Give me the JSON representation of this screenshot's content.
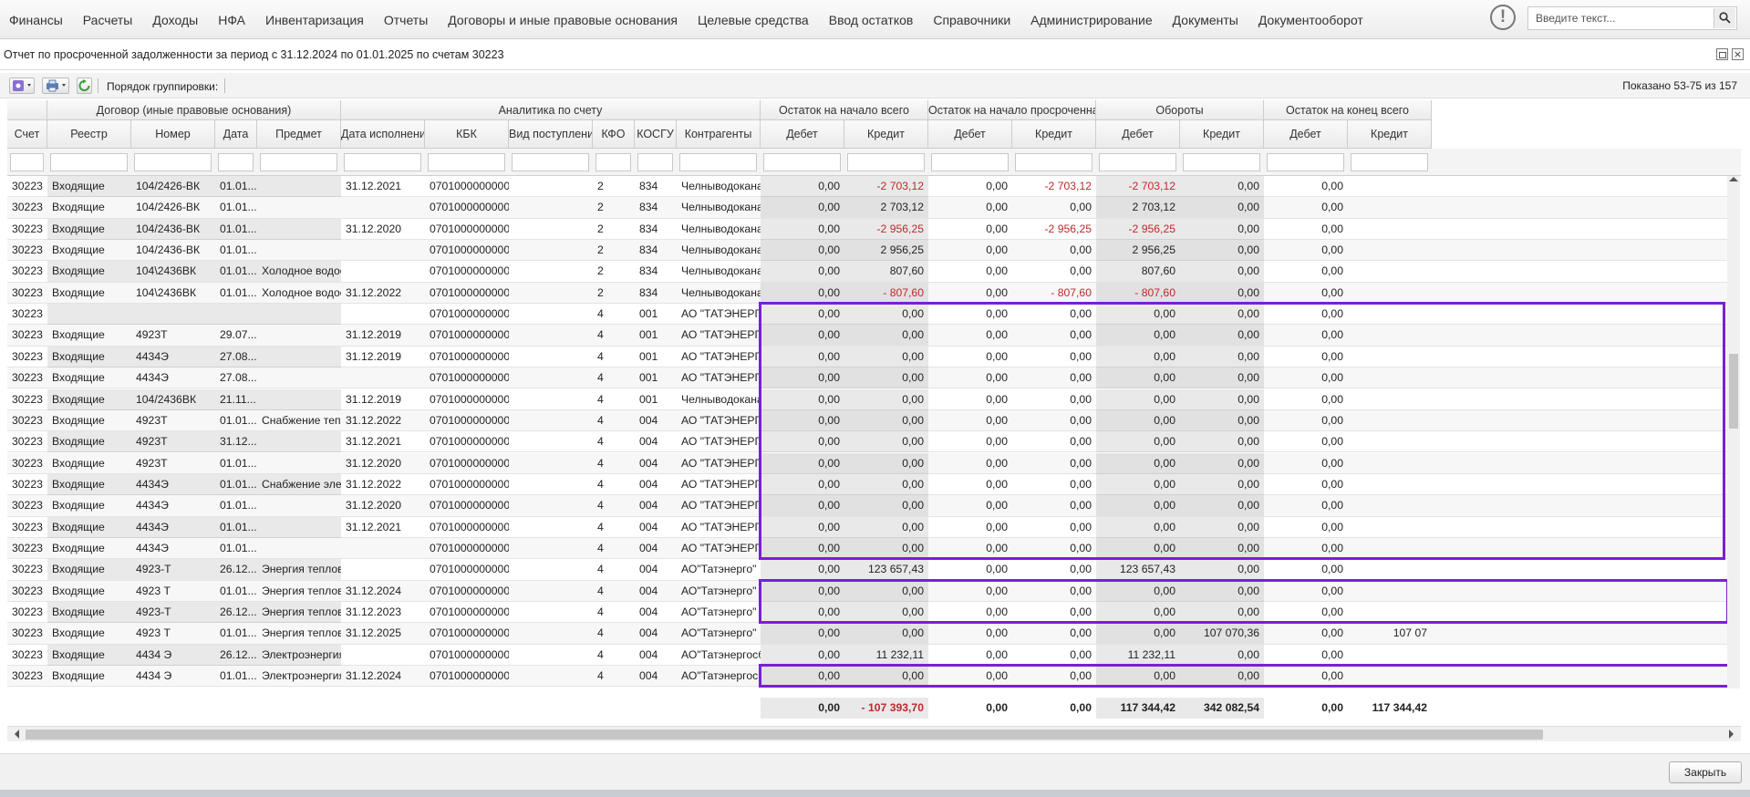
{
  "menu": [
    "Финансы",
    "Расчеты",
    "Доходы",
    "НФА",
    "Инвентаризация",
    "Отчеты",
    "Договоры и иные правовые основания",
    "Целевые средства",
    "Ввод остатков",
    "Справочники",
    "Администрирование",
    "Документы",
    "Документооборот"
  ],
  "search": {
    "placeholder": "Введите текст..."
  },
  "alert_icon": "!",
  "window": {
    "title": "Отчет по просроченной задолженности за период с 31.12.2024 по 01.01.2025 по счетам 30223"
  },
  "toolbar": {
    "grouping_label": "Порядок группировки:",
    "shown": "Показано 53-75 из 157"
  },
  "table": {
    "groups": [
      "Договор (иные правовые основания)",
      "Аналитика по счету",
      "Остаток на начало всего",
      "Остаток на начало просроченная",
      "Обороты",
      "Остаток на конец всего"
    ],
    "columns": [
      "Счет",
      "Реестр",
      "Номер",
      "Дата",
      "Предмет",
      "Дата исполнения",
      "КБК",
      "Вид поступлени...",
      "КФО",
      "КОСГУ",
      "Контрагенты",
      "Дебет",
      "Кредит",
      "Дебет",
      "Кредит",
      "Дебет",
      "Кредит",
      "Дебет",
      "Кредит"
    ],
    "rows": [
      [
        "30223",
        "Входящие",
        "104/2426-ВК",
        "01.01...",
        "",
        "31.12.2021",
        "0701000000000...",
        "",
        "2",
        "834",
        "Челныводокана...",
        "0,00",
        "-2 703,12",
        "0,00",
        "-2 703,12",
        "-2 703,12",
        "0,00",
        "0,00",
        ""
      ],
      [
        "30223",
        "Входящие",
        "104/2426-ВК",
        "01.01...",
        "",
        "",
        "0701000000000...",
        "",
        "2",
        "834",
        "Челныводокана...",
        "0,00",
        "2 703,12",
        "0,00",
        "0,00",
        "2 703,12",
        "0,00",
        "0,00",
        ""
      ],
      [
        "30223",
        "Входящие",
        "104/2436-ВК",
        "01.01...",
        "",
        "31.12.2020",
        "0701000000000...",
        "",
        "2",
        "834",
        "Челныводокана...",
        "0,00",
        "-2 956,25",
        "0,00",
        "-2 956,25",
        "-2 956,25",
        "0,00",
        "0,00",
        ""
      ],
      [
        "30223",
        "Входящие",
        "104/2436-ВК",
        "01.01...",
        "",
        "",
        "0701000000000...",
        "",
        "2",
        "834",
        "Челныводокана...",
        "0,00",
        "2 956,25",
        "0,00",
        "0,00",
        "2 956,25",
        "0,00",
        "0,00",
        ""
      ],
      [
        "30223",
        "Входящие",
        "104\\2436ВК",
        "01.01...",
        "Холодное водос...",
        "",
        "0701000000000...",
        "",
        "2",
        "834",
        "Челныводокана...",
        "0,00",
        "807,60",
        "0,00",
        "0,00",
        "807,60",
        "0,00",
        "0,00",
        ""
      ],
      [
        "30223",
        "Входящие",
        "104\\2436ВК",
        "01.01...",
        "Холодное водос...",
        "31.12.2022",
        "0701000000000...",
        "",
        "2",
        "834",
        "Челныводокана...",
        "0,00",
        "- 807,60",
        "0,00",
        "- 807,60",
        "- 807,60",
        "0,00",
        "0,00",
        ""
      ],
      [
        "30223",
        "",
        "",
        "",
        "",
        "",
        "0701000000000...",
        "",
        "4",
        "001",
        "АО \"ТАТЭНЕРГО\"",
        "0,00",
        "0,00",
        "0,00",
        "0,00",
        "0,00",
        "0,00",
        "0,00",
        ""
      ],
      [
        "30223",
        "Входящие",
        "4923Т",
        "29.07...",
        "",
        "31.12.2019",
        "0701000000000...",
        "",
        "4",
        "001",
        "АО \"ТАТЭНЕРГО\"",
        "0,00",
        "0,00",
        "0,00",
        "0,00",
        "0,00",
        "0,00",
        "0,00",
        ""
      ],
      [
        "30223",
        "Входящие",
        "4434Э",
        "27.08...",
        "",
        "31.12.2019",
        "0701000000000...",
        "",
        "4",
        "001",
        "АО \"ТАТЭНЕРГ...",
        "0,00",
        "0,00",
        "0,00",
        "0,00",
        "0,00",
        "0,00",
        "0,00",
        ""
      ],
      [
        "30223",
        "Входящие",
        "4434Э",
        "27.08...",
        "",
        "",
        "0701000000000...",
        "",
        "4",
        "001",
        "АО \"ТАТЭНЕРГ...",
        "0,00",
        "0,00",
        "0,00",
        "0,00",
        "0,00",
        "0,00",
        "0,00",
        ""
      ],
      [
        "30223",
        "Входящие",
        "104/2436ВК",
        "21.11...",
        "",
        "31.12.2019",
        "0701000000000...",
        "",
        "4",
        "001",
        "Челныводокана...",
        "0,00",
        "0,00",
        "0,00",
        "0,00",
        "0,00",
        "0,00",
        "0,00",
        ""
      ],
      [
        "30223",
        "Входящие",
        "4923Т",
        "01.01...",
        "Снабжение теп...",
        "31.12.2022",
        "0701000000000...",
        "",
        "4",
        "004",
        "АО \"ТАТЭНЕРГО\"",
        "0,00",
        "0,00",
        "0,00",
        "0,00",
        "0,00",
        "0,00",
        "0,00",
        ""
      ],
      [
        "30223",
        "Входящие",
        "4923Т",
        "31.12...",
        "",
        "31.12.2021",
        "0701000000000...",
        "",
        "4",
        "004",
        "АО \"ТАТЭНЕРГО\"",
        "0,00",
        "0,00",
        "0,00",
        "0,00",
        "0,00",
        "0,00",
        "0,00",
        ""
      ],
      [
        "30223",
        "Входящие",
        "4923Т",
        "01.01...",
        "",
        "31.12.2020",
        "0701000000000...",
        "",
        "4",
        "004",
        "АО \"ТАТЭНЕРГО\"",
        "0,00",
        "0,00",
        "0,00",
        "0,00",
        "0,00",
        "0,00",
        "0,00",
        ""
      ],
      [
        "30223",
        "Входящие",
        "4434Э",
        "01.01...",
        "Снабжение эле...",
        "31.12.2022",
        "0701000000000...",
        "",
        "4",
        "004",
        "АО \"ТАТЭНЕРГ...",
        "0,00",
        "0,00",
        "0,00",
        "0,00",
        "0,00",
        "0,00",
        "0,00",
        ""
      ],
      [
        "30223",
        "Входящие",
        "4434Э",
        "01.01...",
        "",
        "31.12.2020",
        "0701000000000...",
        "",
        "4",
        "004",
        "АО \"ТАТЭНЕРГ...",
        "0,00",
        "0,00",
        "0,00",
        "0,00",
        "0,00",
        "0,00",
        "0,00",
        ""
      ],
      [
        "30223",
        "Входящие",
        "4434Э",
        "01.01...",
        "",
        "31.12.2021",
        "0701000000000...",
        "",
        "4",
        "004",
        "АО \"ТАТЭНЕРГ...",
        "0,00",
        "0,00",
        "0,00",
        "0,00",
        "0,00",
        "0,00",
        "0,00",
        ""
      ],
      [
        "30223",
        "Входящие",
        "4434Э",
        "01.01...",
        "",
        "",
        "0701000000000...",
        "",
        "4",
        "004",
        "АО \"ТАТЭНЕРГ...",
        "0,00",
        "0,00",
        "0,00",
        "0,00",
        "0,00",
        "0,00",
        "0,00",
        ""
      ],
      [
        "30223",
        "Входящие",
        "4923-Т",
        "26.12...",
        "Энергия теплов...",
        "",
        "0701000000000...",
        "",
        "4",
        "004",
        "АО\"Татэнерго\"",
        "0,00",
        "123 657,43",
        "0,00",
        "0,00",
        "123 657,43",
        "0,00",
        "0,00",
        ""
      ],
      [
        "30223",
        "Входящие",
        "4923 Т",
        "01.01...",
        "Энергия теплов...",
        "31.12.2024",
        "0701000000000...",
        "",
        "4",
        "004",
        "АО\"Татэнерго\"",
        "0,00",
        "0,00",
        "0,00",
        "0,00",
        "0,00",
        "0,00",
        "0,00",
        ""
      ],
      [
        "30223",
        "Входящие",
        "4923-Т",
        "26.12...",
        "Энергия теплов...",
        "31.12.2023",
        "0701000000000...",
        "",
        "4",
        "004",
        "АО\"Татэнерго\"",
        "0,00",
        "0,00",
        "0,00",
        "0,00",
        "0,00",
        "0,00",
        "0,00",
        ""
      ],
      [
        "30223",
        "Входящие",
        "4923 Т",
        "01.01...",
        "Энергия теплов...",
        "31.12.2025",
        "0701000000000...",
        "",
        "4",
        "004",
        "АО\"Татэнерго\"",
        "0,00",
        "0,00",
        "0,00",
        "0,00",
        "0,00",
        "107 070,36",
        "0,00",
        "107 07"
      ],
      [
        "30223",
        "Входящие",
        "4434 Э",
        "26.12...",
        "Электроэнергия...",
        "",
        "0701000000000...",
        "",
        "4",
        "004",
        "АО\"Татэнергосб...",
        "0,00",
        "11 232,11",
        "0,00",
        "0,00",
        "11 232,11",
        "0,00",
        "0,00",
        ""
      ],
      [
        "30223",
        "Входящие",
        "4434 Э",
        "01.01...",
        "Электроэнергия...",
        "31.12.2024",
        "0701000000000...",
        "",
        "4",
        "004",
        "АО\"Татэнергосб...",
        "0,00",
        "0,00",
        "0,00",
        "0,00",
        "0,00",
        "0,00",
        "0,00",
        ""
      ]
    ],
    "totals": [
      "0,00",
      "- 107 393,70",
      "0,00",
      "0,00",
      "117 344,42",
      "342 082,54",
      "0,00",
      "117 344,42"
    ]
  },
  "footer": {
    "close_label": "Закрыть"
  },
  "colors": {
    "highlight": "#7a1fd6",
    "negative": "#c0282d"
  }
}
